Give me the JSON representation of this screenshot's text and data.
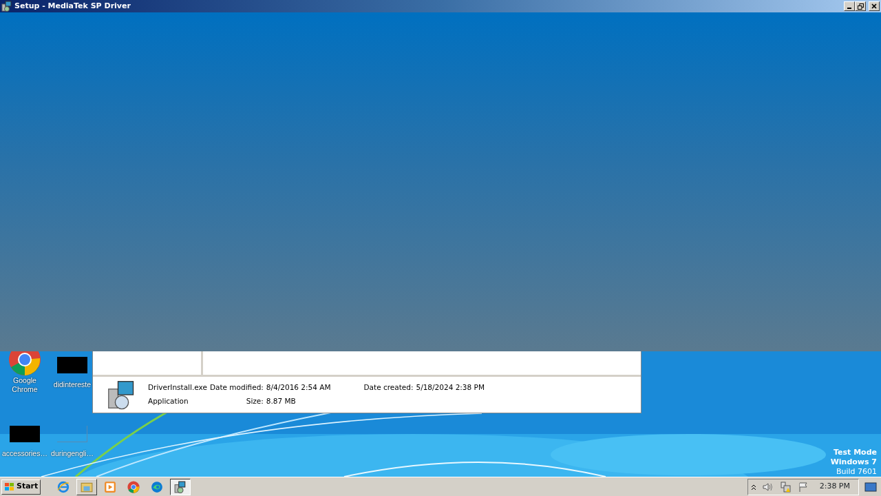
{
  "window": {
    "title": "Setup - MediaTek SP Driver"
  },
  "desktop": {
    "icons": [
      {
        "label": "Google Chrome",
        "kind": "chrome"
      },
      {
        "label": "didintereste",
        "kind": "redacted"
      },
      {
        "label": "accessories…",
        "kind": "redacted"
      },
      {
        "label": "duringengli…",
        "kind": "blank"
      }
    ]
  },
  "explorer": {
    "details": {
      "file_name": "DriverInstall.exe",
      "file_type": "Application",
      "date_modified_label": "Date modified:",
      "date_modified": "8/4/2016 2:54 AM",
      "size_label": "Size:",
      "size": "8.87 MB",
      "date_created_label": "Date created:",
      "date_created": "5/18/2024 2:38 PM"
    }
  },
  "system_info": [
    "Test Mode",
    "Windows 7",
    "Build 7601"
  ],
  "taskbar": {
    "start": "Start",
    "buttons": [
      {
        "kind": "ie",
        "running": false,
        "selected": false
      },
      {
        "kind": "explorer",
        "running": true,
        "selected": false
      },
      {
        "kind": "media",
        "running": false,
        "selected": false
      },
      {
        "kind": "chrome",
        "running": false,
        "selected": false
      },
      {
        "kind": "edge",
        "running": false,
        "selected": false
      },
      {
        "kind": "setup",
        "running": true,
        "selected": true
      }
    ],
    "clock": "2:38 PM"
  }
}
